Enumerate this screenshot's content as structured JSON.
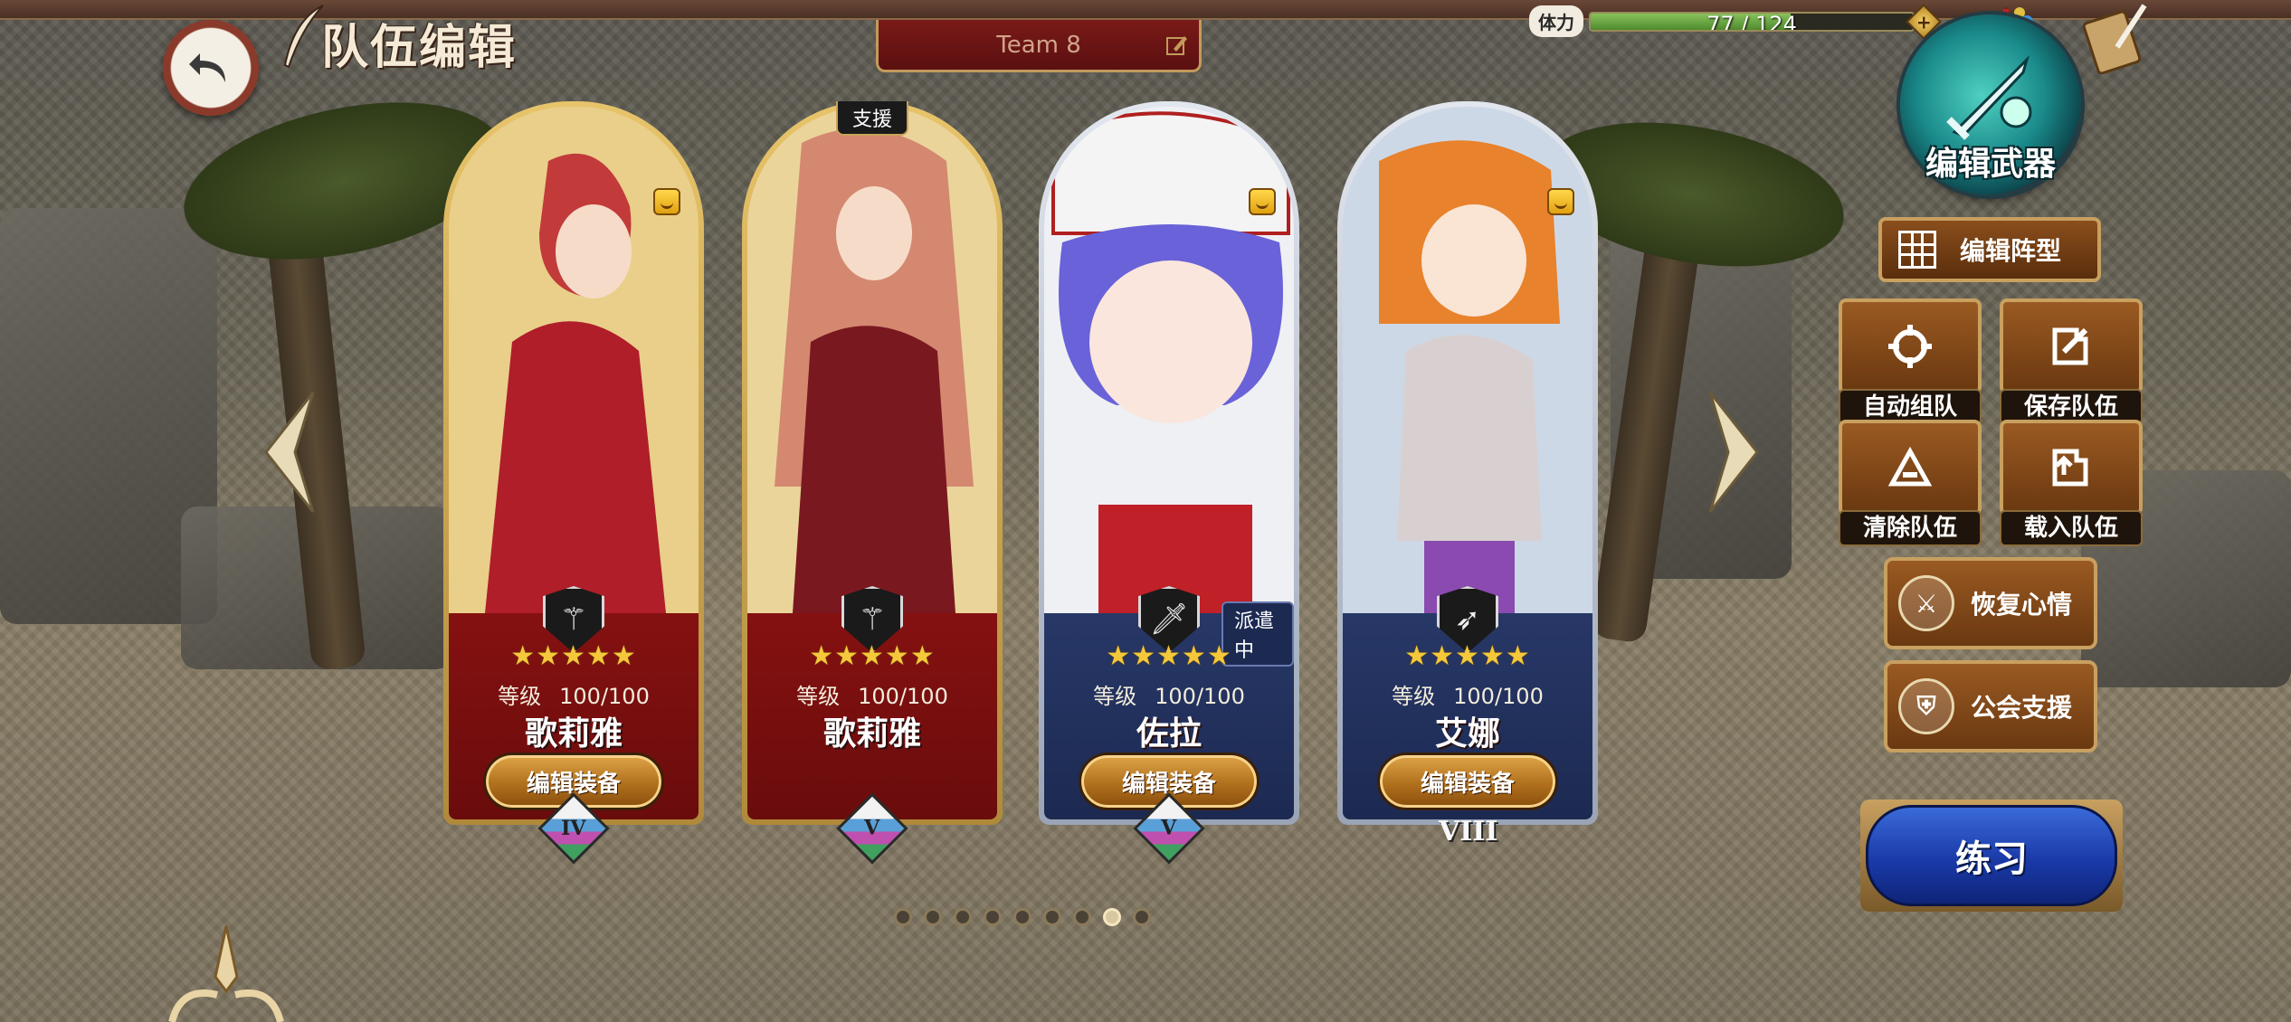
{
  "header": {
    "title": "队伍编辑",
    "team_name": "Team 8",
    "stamina_label": "体力",
    "stamina_text": "77 / 124",
    "stamina_fraction": 0.621,
    "stamina_plus": "+"
  },
  "weapon": {
    "label": "编辑武器"
  },
  "cards": [
    {
      "level_label": "等级",
      "level": "100/100",
      "name": "歌莉雅",
      "equip_label": "编辑装备",
      "rank": "IV",
      "stars": "★★★★★",
      "class_icon": "staff-icon",
      "theme": "red"
    },
    {
      "tag": "支援",
      "level_label": "等级",
      "level": "100/100",
      "name": "歌莉雅",
      "equip_label": "编辑装备",
      "rank": "V",
      "stars": "★★★★★",
      "class_icon": "staff-icon",
      "theme": "red"
    },
    {
      "status": "派遣中",
      "level_label": "等级",
      "level": "100/100",
      "name": "佐拉",
      "equip_label": "编辑装备",
      "rank": "V",
      "stars": "★★★★★",
      "class_icon": "sword-icon",
      "theme": "blue"
    },
    {
      "level_label": "等级",
      "level": "100/100",
      "name": "艾娜",
      "equip_label": "编辑装备",
      "rank": "VIII",
      "stars": "★★★★★",
      "class_icon": "bow-icon",
      "theme": "blue"
    }
  ],
  "pagination": {
    "total": 9,
    "active_index": 7
  },
  "side_menu": {
    "formation": "编辑阵型",
    "auto_team": "自动组队",
    "save_team": "保存队伍",
    "clear_team": "清除队伍",
    "load_team": "载入队伍",
    "restore_mood": "恢复心情",
    "guild_support": "公会支援",
    "practice": "练习"
  },
  "colors": {
    "card_red": "#8a1212",
    "card_blue": "#1c2a52",
    "button_gold": "#b0701c",
    "practice_blue": "#1a3aa8",
    "stamina_green": "#4f8a2e"
  }
}
